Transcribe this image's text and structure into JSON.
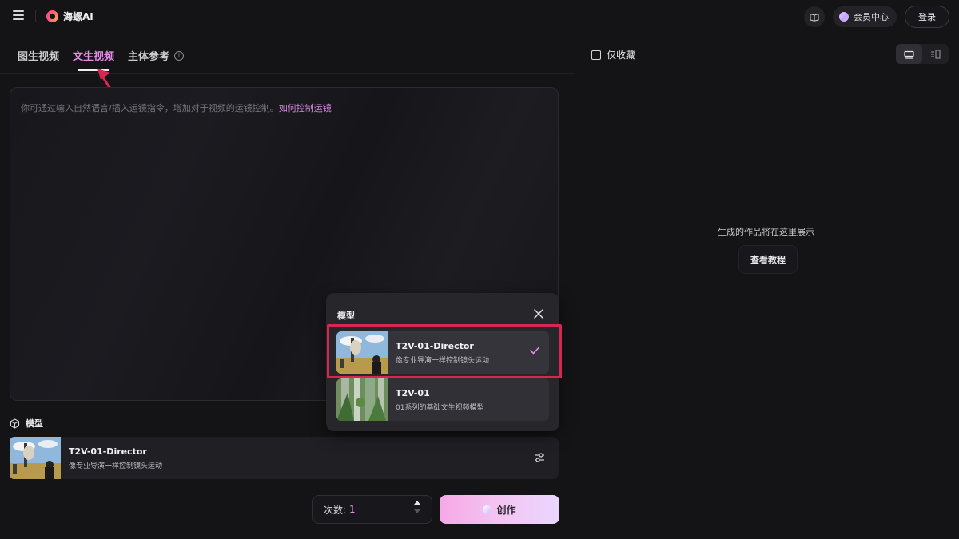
{
  "header": {
    "app_name": "海螺AI",
    "member_label": "会员中心",
    "login_label": "登录"
  },
  "tabs": [
    {
      "label": "图生视频",
      "active": false
    },
    {
      "label": "文生视频",
      "active": true
    },
    {
      "label": "主体参考",
      "active": false
    }
  ],
  "prompt": {
    "placeholder": "你可通过输入自然语言/插入运镜指令，增加对于视频的运镜控制。",
    "link": "如何控制运镜"
  },
  "model_section": {
    "title": "模型",
    "selected": {
      "name": "T2V-01-Director",
      "description": "像专业导演一样控制镜头运动"
    }
  },
  "dropdown": {
    "title": "模型",
    "options": [
      {
        "name": "T2V-01-Director",
        "description": "像专业导演一样控制镜头运动",
        "selected": true
      },
      {
        "name": "T2V-01",
        "description": "01系列的基础文生视频模型",
        "selected": false
      }
    ]
  },
  "generate": {
    "count_label": "次数:",
    "count_value": "1",
    "create_label": "创作"
  },
  "gallery": {
    "favorites_label": "仅收藏",
    "empty_text": "生成的作品将在这里展示",
    "tutorial_label": "查看教程"
  },
  "colors": {
    "accent": "#e48de6",
    "highlight_box": "#d7264f",
    "background": "#141417"
  },
  "icons": [
    "menu-icon",
    "logo-icon",
    "book-icon",
    "gem-icon",
    "info-icon",
    "cube-icon",
    "sliders-icon",
    "close-icon",
    "check-icon",
    "chevron-up-icon",
    "chevron-down-icon",
    "list-view-icon",
    "detail-view-icon"
  ]
}
